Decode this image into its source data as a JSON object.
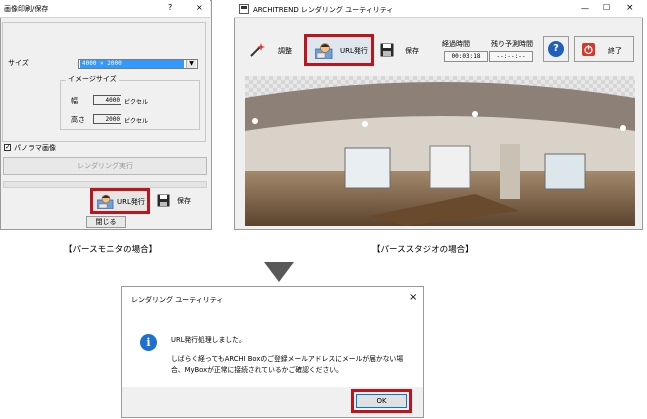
{
  "left_dialog": {
    "title": "画像印刷/保存",
    "help_button": "?",
    "close_button": "×",
    "size_label": "サイズ",
    "size_value": "4000 × 2000",
    "image_size_group": "イメージサイズ",
    "width_label": "幅",
    "width_value": "4000",
    "height_label": "高さ",
    "height_value": "2000",
    "unit": "ピクセル",
    "panorama_label": "パノラマ画像",
    "panorama_checked": "✓",
    "render_button": "レンダリング実行",
    "url_button": "URL発行",
    "save_button": "保存",
    "close_label": "閉じる"
  },
  "right_dialog": {
    "title": "ARCHITREND レンダリング ユーティリティ",
    "adjust_button": "調整",
    "url_button": "URL発行",
    "save_button": "保存",
    "elapsed_label": "経過時間",
    "elapsed_value": "00:03:18",
    "remaining_label": "残り予測時間",
    "remaining_value": "--:--:--",
    "help_button": "?",
    "end_button": "終了",
    "minimize": "—",
    "maximize": "☐",
    "close": "×"
  },
  "captions": {
    "left": "【パースモニタの場合】",
    "right": "【パーススタジオの場合】"
  },
  "message_dialog": {
    "title": "レンダリング ユーティリティ",
    "close": "×",
    "line1": "URL発行処理しました。",
    "line2": "しばらく経ってもARCHI Boxのご登録メールアドレスにメールが届かない場",
    "line3": "合、MyBoxが正常に接続されているかご確認ください。",
    "ok_button": "OK"
  },
  "colors": {
    "highlight_red": "#c0141d",
    "selection_blue": "#3399ff",
    "info_blue": "#1f6fd1"
  }
}
